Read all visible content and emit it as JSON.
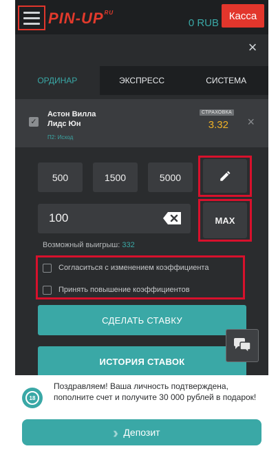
{
  "header": {
    "logo_text": "PIN-UP",
    "logo_suffix": "RU",
    "balance": "0 RUB",
    "cashier_label": "Касса"
  },
  "coupon": {
    "close_glyph": "×"
  },
  "tabs": [
    {
      "label": "ОРДИНАР",
      "active": true
    },
    {
      "label": "ЭКСПРЕСС",
      "active": false
    },
    {
      "label": "СИСТЕМА",
      "active": false
    }
  ],
  "bet": {
    "team_home": "Астон Вилла",
    "team_away": "Лидс Юн",
    "outcome": "П2: Исход",
    "insurance_label": "СТРАХОВКА",
    "odds": "3.32",
    "remove_glyph": "×"
  },
  "quick_amounts": [
    "500",
    "1500",
    "5000"
  ],
  "stake": {
    "value": "100",
    "max_label": "MAX"
  },
  "possible_win": {
    "label": "Возможный выигрыш:",
    "value": "332"
  },
  "options": [
    {
      "label": "Согласиться с изменением коэффициента",
      "checked": false
    },
    {
      "label": "Принять повышение коэффициентов",
      "checked": false
    }
  ],
  "actions": {
    "place_bet_label": "СДЕЛАТЬ СТАВКУ",
    "history_label": "ИСТОРИЯ СТАВОК"
  },
  "notification": {
    "age_badge": "18",
    "text": "Поздравляем! Ваша личность подтверждена, пополните счет и получите 30 000 рублей в подарок!",
    "deposit_label": "Депозит"
  },
  "colors": {
    "brand_red": "#e2362c",
    "accent_teal": "#3aa8a6",
    "odds_yellow": "#f0b226",
    "highlight_red": "#d8112c"
  }
}
